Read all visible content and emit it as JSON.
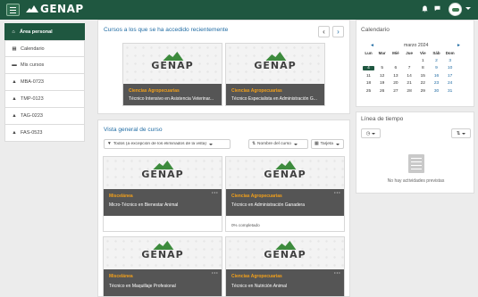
{
  "navbar": {
    "logo_text": "GENAP",
    "bell_icon": "bell-icon",
    "chat_icon": "chat-icon"
  },
  "drawer": {
    "items": [
      {
        "label": "Área personal",
        "icon": "home-icon"
      },
      {
        "label": "Calendario",
        "icon": "calendar-icon"
      },
      {
        "label": "Mis cursos",
        "icon": "folder-icon"
      },
      {
        "label": "MBA-0723",
        "icon": "graduation-cap-icon"
      },
      {
        "label": "TMP-0123",
        "icon": "graduation-cap-icon"
      },
      {
        "label": "TAG-0223",
        "icon": "graduation-cap-icon"
      },
      {
        "label": "FAS-0523",
        "icon": "graduation-cap-icon"
      }
    ]
  },
  "recent": {
    "title": "Cursos a los que se ha accedido recientemente",
    "courses": [
      {
        "category": "Ciencias Agropecuarias",
        "name": "Técnico Intensivo en Asistencia Veterinar..."
      },
      {
        "category": "Ciencias Agropecuarias",
        "name": "Técnico Especialista en Administración G..."
      }
    ]
  },
  "overview": {
    "title": "Vista general de curso",
    "filter_label": "Todos (a excepción de los eliminados de la vista)",
    "sort_label": "Nombre del curso",
    "view_label": "Tarjeta",
    "courses": [
      {
        "category": "Miscelánea",
        "name": "Micro-Técnico en Bienestar Animal",
        "progress": ""
      },
      {
        "category": "Ciencias Agropecuarias",
        "name": "Técnico en Administración Ganadera",
        "progress": "0% completado"
      },
      {
        "category": "Miscelánea",
        "name": "Técnico en Maquillaje Profesional",
        "progress": ""
      },
      {
        "category": "Ciencias Agropecuarias",
        "name": "Técnico en Nutrición Animal",
        "progress": ""
      }
    ]
  },
  "calendar": {
    "title": "Calendario",
    "month": "marzo 2024",
    "prev": "◄",
    "next": "►",
    "weekdays": [
      "Lun",
      "Mar",
      "Mié",
      "Jue",
      "Vie",
      "Sáb",
      "Dom"
    ],
    "weeks": [
      [
        "",
        "",
        "",
        "",
        "1",
        "2",
        "3"
      ],
      [
        "4",
        "5",
        "6",
        "7",
        "8",
        "9",
        "10"
      ],
      [
        "11",
        "12",
        "13",
        "14",
        "15",
        "16",
        "17"
      ],
      [
        "18",
        "19",
        "20",
        "21",
        "22",
        "23",
        "24"
      ],
      [
        "25",
        "26",
        "27",
        "28",
        "29",
        "30",
        "31"
      ]
    ],
    "today": "4"
  },
  "timeline": {
    "title": "Línea de tiempo",
    "empty_text": "No hay actividades previstas"
  },
  "colors": {
    "brand": "#1f5740",
    "link": "#1f6ba3",
    "category": "#f2a01b"
  }
}
